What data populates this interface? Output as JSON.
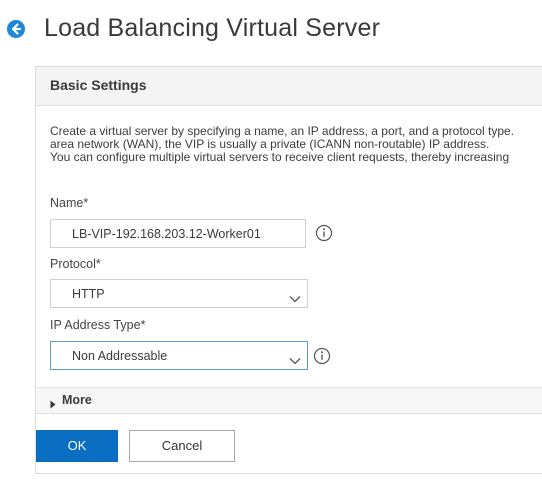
{
  "header": {
    "title": "Load Balancing Virtual Server",
    "back_icon": "back-arrow-icon",
    "accent": "#1e87d6"
  },
  "panel": {
    "title": "Basic Settings",
    "description": [
      "Create a virtual server by specifying a name, an IP address, a port, and a protocol type.",
      "area network (WAN), the VIP is usually a private (ICANN non-routable) IP address.",
      "You can configure multiple virtual servers to receive client requests, thereby increasing"
    ]
  },
  "form": {
    "name": {
      "label": "Name*",
      "value": "LB-VIP-192.168.203.12-Worker01"
    },
    "protocol": {
      "label": "Protocol*",
      "value": "HTTP"
    },
    "ip_address_type": {
      "label": "IP Address Type*",
      "value": "Non Addressable"
    }
  },
  "more": {
    "label": "More"
  },
  "actions": {
    "ok_label": "OK",
    "cancel_label": "Cancel",
    "ok_color": "#0a6fc2"
  }
}
